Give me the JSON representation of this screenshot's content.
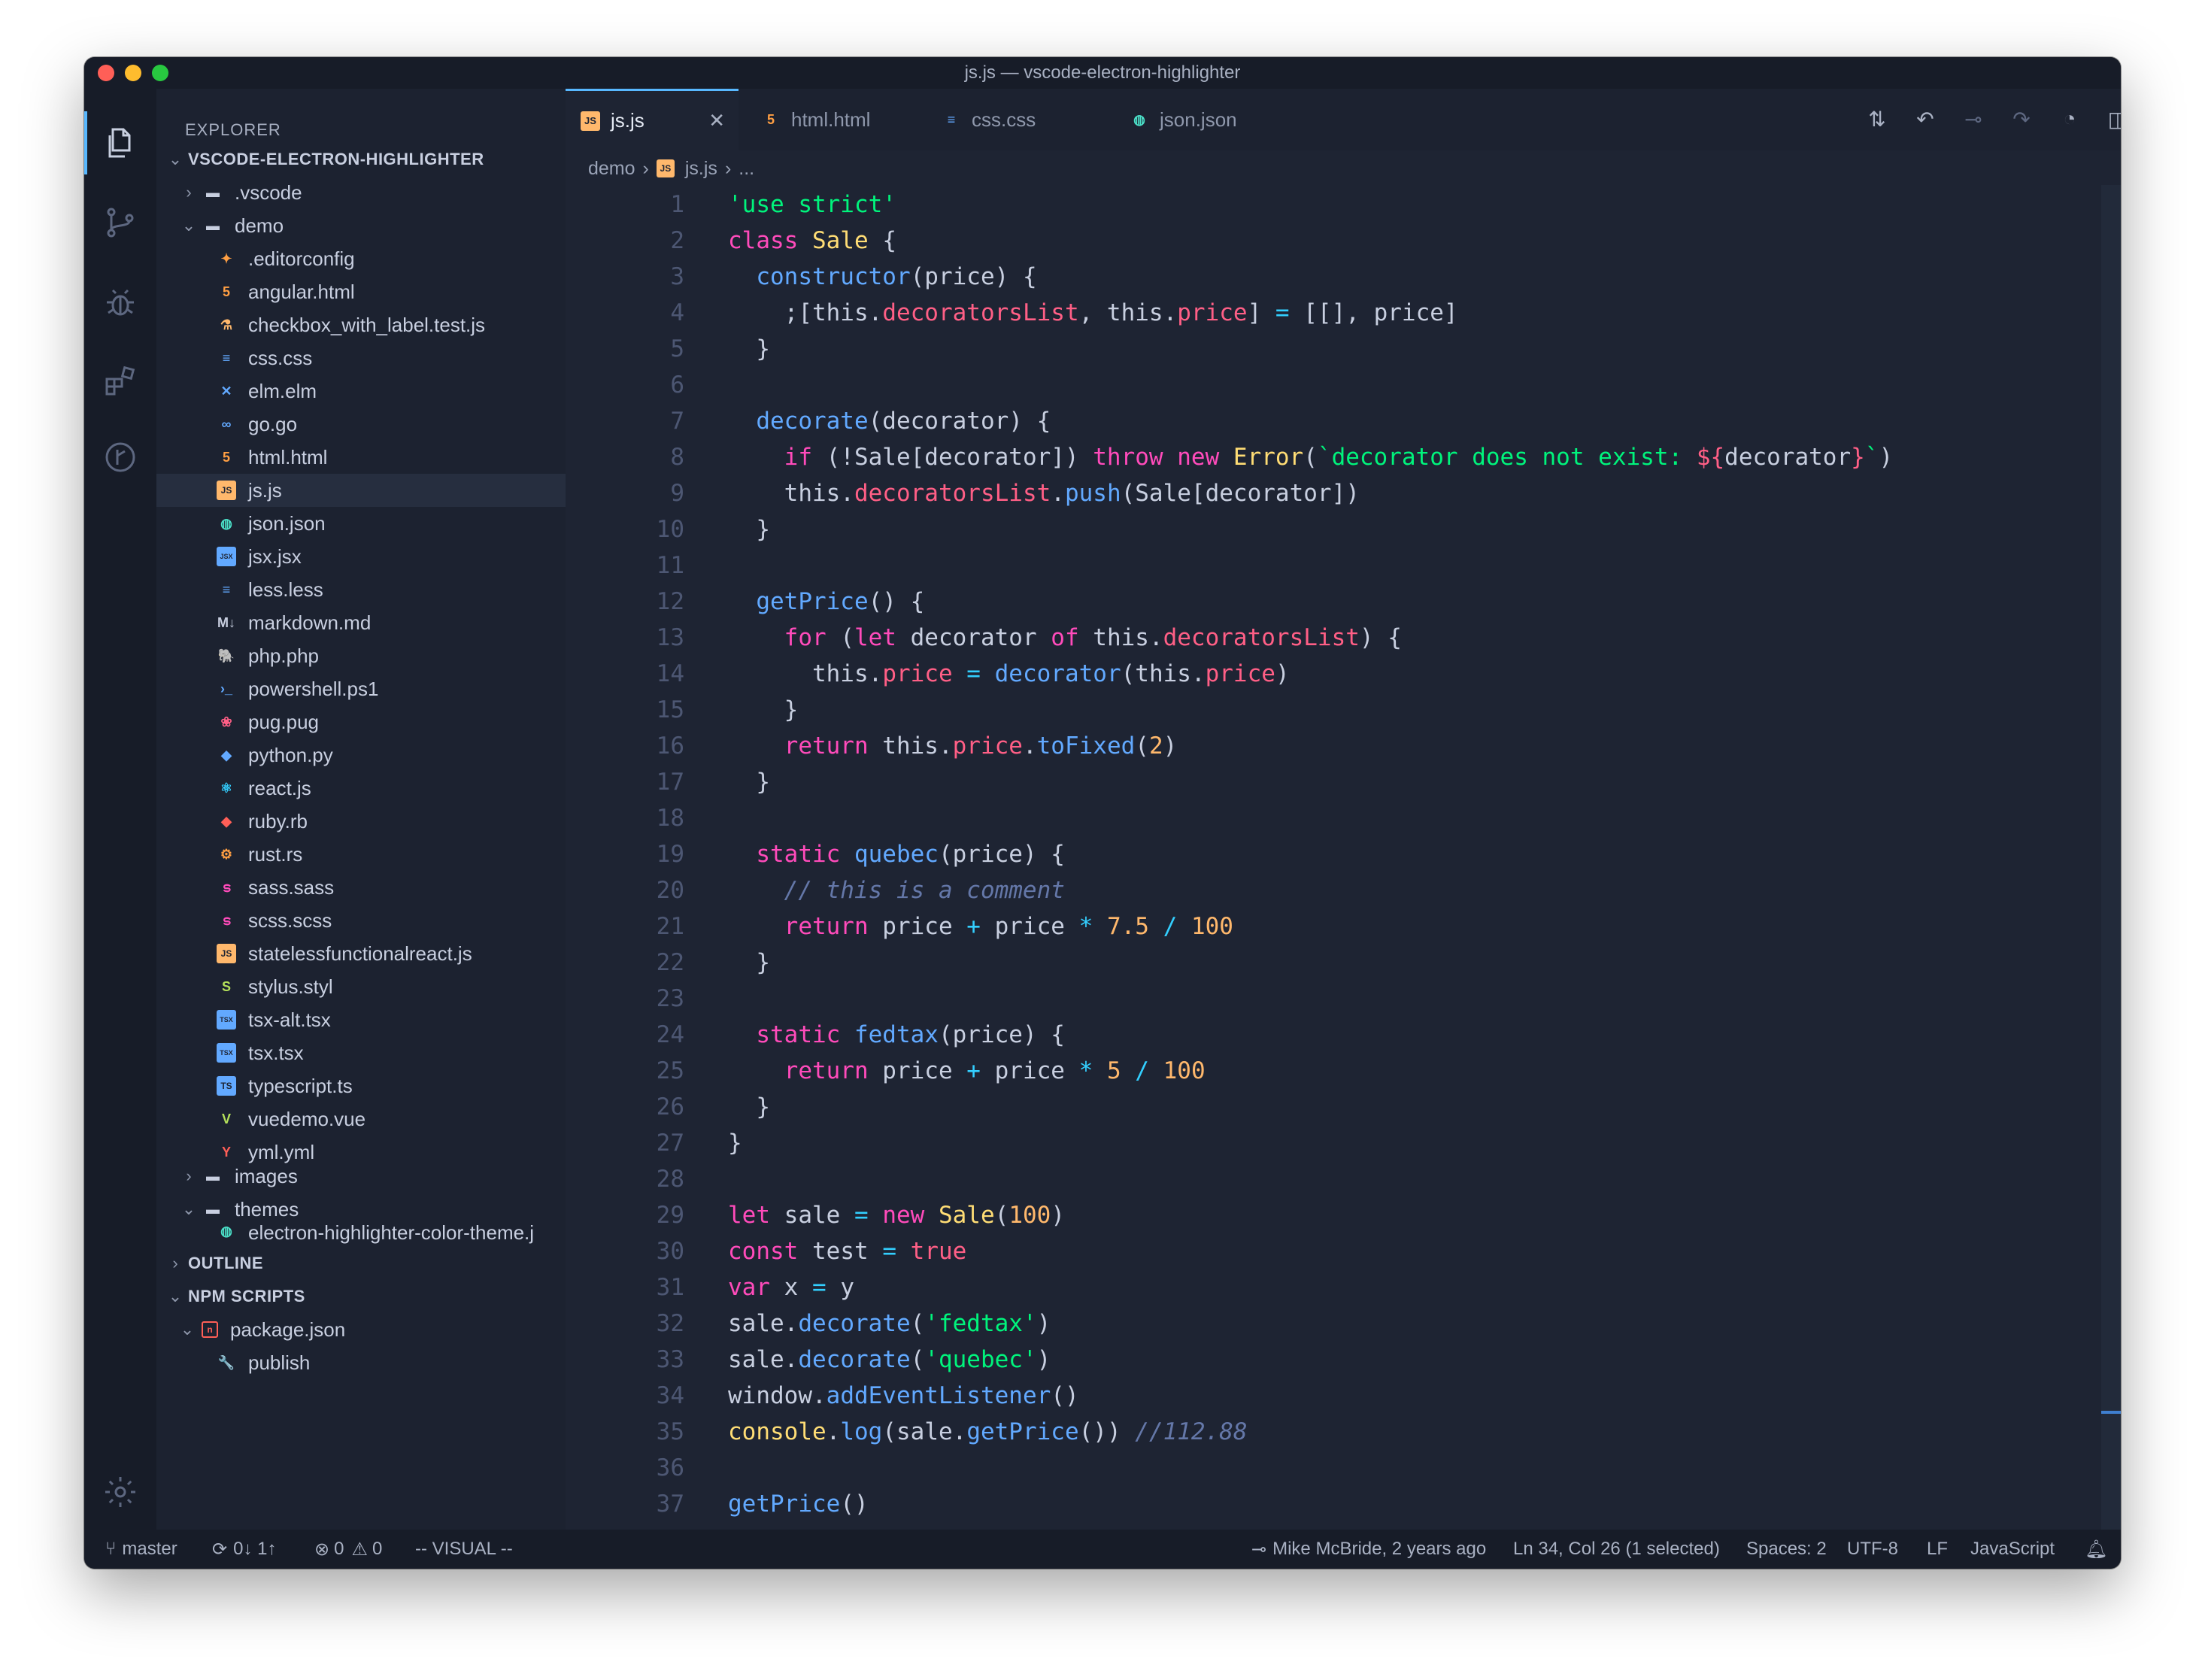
{
  "window": {
    "title": "js.js — vscode-electron-highlighter"
  },
  "sidebar": {
    "header": "EXPLORER",
    "project": "VSCODE-ELECTRON-HIGHLIGHTER",
    "folders": {
      "vscode": ".vscode",
      "demo": "demo",
      "images": "images",
      "themes": "themes"
    },
    "files": [
      {
        "name": ".editorconfig",
        "icon": "editorconfig-icon",
        "glyph": "✦",
        "color": "#ff9f43",
        "bg": ""
      },
      {
        "name": "angular.html",
        "icon": "html-icon",
        "glyph": "5",
        "color": "#ff9f43",
        "bg": ""
      },
      {
        "name": "checkbox_with_label.test.js",
        "icon": "test-js-icon",
        "glyph": "⚗",
        "color": "#ffb86c",
        "bg": ""
      },
      {
        "name": "css.css",
        "icon": "css-icon",
        "glyph": "≡",
        "color": "#62a9ff",
        "bg": ""
      },
      {
        "name": "elm.elm",
        "icon": "elm-icon",
        "glyph": "✕",
        "color": "#62a9ff",
        "bg": ""
      },
      {
        "name": "go.go",
        "icon": "go-icon",
        "glyph": "∞",
        "color": "#62a9ff",
        "bg": ""
      },
      {
        "name": "html.html",
        "icon": "html-icon",
        "glyph": "5",
        "color": "#ff9f43",
        "bg": ""
      },
      {
        "name": "js.js",
        "icon": "js-icon",
        "glyph": "JS",
        "color": "#1e2433",
        "bg": "#ffb86c"
      },
      {
        "name": "json.json",
        "icon": "json-icon",
        "glyph": "◍",
        "color": "#4be0c8",
        "bg": ""
      },
      {
        "name": "jsx.jsx",
        "icon": "jsx-icon",
        "glyph": "JSX",
        "color": "#1e2433",
        "bg": "#62a9ff"
      },
      {
        "name": "less.less",
        "icon": "less-icon",
        "glyph": "≡",
        "color": "#62a9ff",
        "bg": ""
      },
      {
        "name": "markdown.md",
        "icon": "markdown-icon",
        "glyph": "M↓",
        "color": "#c8cfe0",
        "bg": ""
      },
      {
        "name": "php.php",
        "icon": "php-icon",
        "glyph": "🐘",
        "color": "#62a9ff",
        "bg": ""
      },
      {
        "name": "powershell.ps1",
        "icon": "powershell-icon",
        "glyph": "›_",
        "color": "#62a9ff",
        "bg": ""
      },
      {
        "name": "pug.pug",
        "icon": "pug-icon",
        "glyph": "❀",
        "color": "#ff5f86",
        "bg": ""
      },
      {
        "name": "python.py",
        "icon": "python-icon",
        "glyph": "◆",
        "color": "#62a9ff",
        "bg": ""
      },
      {
        "name": "react.js",
        "icon": "react-icon",
        "glyph": "⚛",
        "color": "#33cfff",
        "bg": ""
      },
      {
        "name": "ruby.rb",
        "icon": "ruby-icon",
        "glyph": "◆",
        "color": "#ff5f57",
        "bg": ""
      },
      {
        "name": "rust.rs",
        "icon": "rust-icon",
        "glyph": "⚙",
        "color": "#ff9f43",
        "bg": ""
      },
      {
        "name": "sass.sass",
        "icon": "sass-icon",
        "glyph": "ട",
        "color": "#ff4bbb",
        "bg": ""
      },
      {
        "name": "scss.scss",
        "icon": "scss-icon",
        "glyph": "ട",
        "color": "#ff4bbb",
        "bg": ""
      },
      {
        "name": "statelessfunctionalreact.js",
        "icon": "js-icon",
        "glyph": "JS",
        "color": "#1e2433",
        "bg": "#ffb86c"
      },
      {
        "name": "stylus.styl",
        "icon": "stylus-icon",
        "glyph": "S",
        "color": "#b4e05a",
        "bg": ""
      },
      {
        "name": "tsx-alt.tsx",
        "icon": "tsx-icon",
        "glyph": "TSX",
        "color": "#1e2433",
        "bg": "#62a9ff"
      },
      {
        "name": "tsx.tsx",
        "icon": "tsx-icon",
        "glyph": "TSX",
        "color": "#1e2433",
        "bg": "#62a9ff"
      },
      {
        "name": "typescript.ts",
        "icon": "typescript-icon",
        "glyph": "TS",
        "color": "#1e2433",
        "bg": "#62a9ff"
      },
      {
        "name": "vuedemo.vue",
        "icon": "vue-icon",
        "glyph": "V",
        "color": "#b4e05a",
        "bg": ""
      },
      {
        "name": "yml.yml",
        "icon": "yaml-icon",
        "glyph": "Y",
        "color": "#ff5f57",
        "bg": ""
      }
    ],
    "theme_file": "electron-highlighter-color-theme.j",
    "outline": "OUTLINE",
    "npm_scripts": "NPM SCRIPTS",
    "package_json": "package.json",
    "publish": "publish"
  },
  "tabs": [
    {
      "label": "js.js",
      "icon": "js-icon"
    },
    {
      "label": "html.html",
      "icon": "html-icon"
    },
    {
      "label": "css.css",
      "icon": "css-icon"
    },
    {
      "label": "json.json",
      "icon": "json-icon"
    }
  ],
  "breadcrumb": {
    "folder": "demo",
    "file": "js.js",
    "more": "..."
  },
  "editor": {
    "lines": [
      [
        [
          "s",
          "'use strict'"
        ]
      ],
      [
        [
          "k",
          "class "
        ],
        [
          "cl",
          "Sale "
        ],
        [
          "b",
          "{"
        ]
      ],
      [
        [
          "b",
          "  "
        ],
        [
          "f",
          "constructor"
        ],
        [
          "b",
          "(price) {"
        ]
      ],
      [
        [
          "b",
          "    ;[this."
        ],
        [
          "p",
          "decoratorsList"
        ],
        [
          "b",
          ", this."
        ],
        [
          "p",
          "price"
        ],
        [
          "b",
          "] "
        ],
        [
          "o",
          "="
        ],
        [
          "b",
          " [[], price]"
        ]
      ],
      [
        [
          "b",
          "  }"
        ]
      ],
      [],
      [
        [
          "b",
          "  "
        ],
        [
          "f",
          "decorate"
        ],
        [
          "b",
          "(decorator) {"
        ]
      ],
      [
        [
          "b",
          "    "
        ],
        [
          "k",
          "if"
        ],
        [
          "b",
          " (!Sale[decorator]) "
        ],
        [
          "k",
          "throw new "
        ],
        [
          "cl",
          "Error"
        ],
        [
          "b",
          "("
        ],
        [
          "s",
          "`decorator does not exist: "
        ],
        [
          "p",
          "${"
        ],
        [
          "b",
          "decorator"
        ],
        [
          "p",
          "}"
        ],
        [
          "s",
          "`"
        ],
        [
          "b",
          ")"
        ]
      ],
      [
        [
          "b",
          "    this."
        ],
        [
          "p",
          "decoratorsList"
        ],
        [
          "b",
          "."
        ],
        [
          "f",
          "push"
        ],
        [
          "b",
          "(Sale[decorator])"
        ]
      ],
      [
        [
          "b",
          "  }"
        ]
      ],
      [],
      [
        [
          "b",
          "  "
        ],
        [
          "f",
          "getPrice"
        ],
        [
          "b",
          "() {"
        ]
      ],
      [
        [
          "b",
          "    "
        ],
        [
          "k",
          "for"
        ],
        [
          "b",
          " ("
        ],
        [
          "k",
          "let"
        ],
        [
          "b",
          " decorator "
        ],
        [
          "k",
          "of"
        ],
        [
          "b",
          " this."
        ],
        [
          "p",
          "decoratorsList"
        ],
        [
          "b",
          ") {"
        ]
      ],
      [
        [
          "b",
          "      this."
        ],
        [
          "p",
          "price"
        ],
        [
          "o",
          " = "
        ],
        [
          "f",
          "decorator"
        ],
        [
          "b",
          "(this."
        ],
        [
          "p",
          "price"
        ],
        [
          "b",
          ")"
        ]
      ],
      [
        [
          "b",
          "    }"
        ]
      ],
      [
        [
          "b",
          "    "
        ],
        [
          "k",
          "return"
        ],
        [
          "b",
          " this."
        ],
        [
          "p",
          "price"
        ],
        [
          "b",
          "."
        ],
        [
          "f",
          "toFixed"
        ],
        [
          "b",
          "("
        ],
        [
          "n",
          "2"
        ],
        [
          "b",
          ")"
        ]
      ],
      [
        [
          "b",
          "  }"
        ]
      ],
      [],
      [
        [
          "b",
          "  "
        ],
        [
          "k",
          "static "
        ],
        [
          "f",
          "quebec"
        ],
        [
          "b",
          "(price) {"
        ]
      ],
      [
        [
          "c",
          "    // this is a comment"
        ]
      ],
      [
        [
          "b",
          "    "
        ],
        [
          "k",
          "return"
        ],
        [
          "b",
          " price "
        ],
        [
          "o",
          "+"
        ],
        [
          "b",
          " price "
        ],
        [
          "o",
          "*"
        ],
        [
          "b",
          " "
        ],
        [
          "n",
          "7.5"
        ],
        [
          "o",
          " / "
        ],
        [
          "n",
          "100"
        ]
      ],
      [
        [
          "b",
          "  }"
        ]
      ],
      [],
      [
        [
          "b",
          "  "
        ],
        [
          "k",
          "static "
        ],
        [
          "f",
          "fedtax"
        ],
        [
          "b",
          "(price) {"
        ]
      ],
      [
        [
          "b",
          "    "
        ],
        [
          "k",
          "return"
        ],
        [
          "b",
          " price "
        ],
        [
          "o",
          "+"
        ],
        [
          "b",
          " price "
        ],
        [
          "o",
          "*"
        ],
        [
          "b",
          " "
        ],
        [
          "n",
          "5"
        ],
        [
          "o",
          " / "
        ],
        [
          "n",
          "100"
        ]
      ],
      [
        [
          "b",
          "  }"
        ]
      ],
      [
        [
          "b",
          "}"
        ]
      ],
      [],
      [
        [
          "k",
          "let"
        ],
        [
          "b",
          " sale "
        ],
        [
          "o",
          "="
        ],
        [
          "b",
          " "
        ],
        [
          "k",
          "new "
        ],
        [
          "cl",
          "Sale"
        ],
        [
          "b",
          "("
        ],
        [
          "n",
          "100"
        ],
        [
          "b",
          ")"
        ]
      ],
      [
        [
          "k",
          "const"
        ],
        [
          "b",
          " test "
        ],
        [
          "o",
          "="
        ],
        [
          "b",
          " "
        ],
        [
          "p",
          "true"
        ]
      ],
      [
        [
          "k",
          "var"
        ],
        [
          "b",
          " x "
        ],
        [
          "o",
          "="
        ],
        [
          "b",
          " y"
        ]
      ],
      [
        [
          "b",
          "sale."
        ],
        [
          "f",
          "decorate"
        ],
        [
          "b",
          "("
        ],
        [
          "s",
          "'fedtax'"
        ],
        [
          "b",
          ")"
        ]
      ],
      [
        [
          "b",
          "sale."
        ],
        [
          "f",
          "decorate"
        ],
        [
          "b",
          "("
        ],
        [
          "s",
          "'quebec'"
        ],
        [
          "b",
          ")"
        ]
      ],
      [
        [
          "b",
          "window."
        ],
        [
          "f",
          "addEventListener"
        ],
        [
          "b",
          "()"
        ]
      ],
      [
        [
          "cl",
          "console"
        ],
        [
          "b",
          "."
        ],
        [
          "f",
          "log"
        ],
        [
          "b",
          "(sale."
        ],
        [
          "f",
          "getPrice"
        ],
        [
          "b",
          "()) "
        ],
        [
          "c",
          "//112.88"
        ]
      ],
      [],
      [
        [
          "f",
          "getPrice"
        ],
        [
          "b",
          "()"
        ]
      ],
      []
    ]
  },
  "status": {
    "branch": "master",
    "sync": "0↓ 1↑",
    "errors": "0",
    "warnings": "0",
    "mode": "-- VISUAL --",
    "blame": "Mike McBride, 2 years ago",
    "position": "Ln 34, Col 26 (1 selected)",
    "spaces": "Spaces: 2",
    "encoding": "UTF-8",
    "eol": "LF",
    "language": "JavaScript"
  },
  "colors": {
    "accent": "#58b8ff",
    "background": "#1e2433",
    "sidebar": "#1c2230"
  }
}
